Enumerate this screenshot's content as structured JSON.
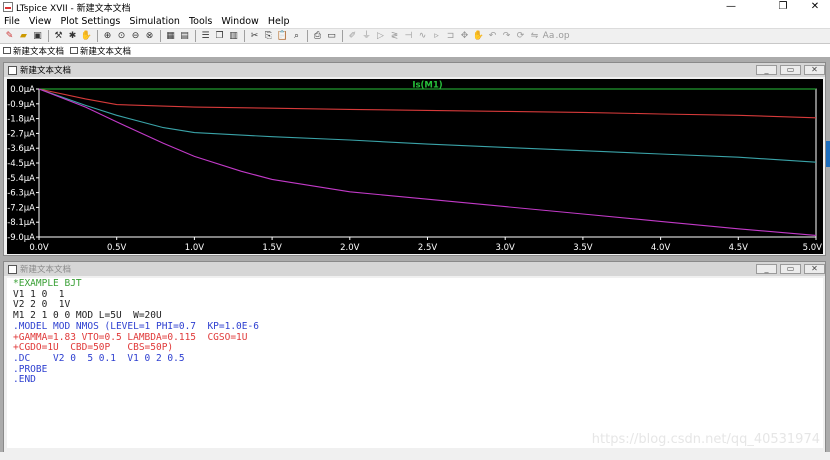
{
  "window": {
    "title": "LTspice XVII - 新建文本文档",
    "minimize": "—",
    "maximize": "❐",
    "close": "✕"
  },
  "menu": [
    "File",
    "View",
    "Plot Settings",
    "Simulation",
    "Tools",
    "Window",
    "Help"
  ],
  "toolbar_icons": [
    "new-schematic",
    "open",
    "save",
    "control-panel",
    "run",
    "halt",
    "zoom-in",
    "zoom-pan",
    "zoom-out",
    "zoom-fit",
    "autorange",
    "fit-all",
    "tile-horizontal",
    "cascade",
    "tile-vertical",
    "cut",
    "copy",
    "paste",
    "find",
    "print",
    "print-setup",
    "draw-wire",
    "ground",
    "label-net",
    "resistor",
    "capacitor",
    "inductor",
    "diode",
    "component",
    "move",
    "drag",
    "undo",
    "redo",
    "rotate",
    "mirror",
    "text",
    "spice-directive"
  ],
  "tabs": [
    {
      "label": "新建文本文档",
      "icon": "waveform-tab-icon"
    },
    {
      "label": "新建文本文档",
      "icon": "netlist-tab-icon"
    }
  ],
  "plot_window": {
    "title": "新建文本文档",
    "min_label": "_",
    "max_label": "▭",
    "close_label": "✕"
  },
  "netlist_window": {
    "title": "新建文本文档",
    "min_label": "_",
    "max_label": "▭",
    "close_label": "✕",
    "lines": [
      {
        "text": "*EXAMPLE BJT",
        "color": "#3aa036"
      },
      {
        "text": "V1 1 0  1",
        "color": "#222222"
      },
      {
        "text": "V2 2 0  1V",
        "color": "#222222"
      },
      {
        "text": "M1 2 1 0 0 MOD L=5U  W=20U",
        "color": "#222222"
      },
      {
        "text": ".MODEL MOD NMOS (LEVEL=1 PHI=0.7  KP=1.0E-6",
        "color": "#2d3fd0"
      },
      {
        "text": "+GAMMA=1.83 VTO=0.5 LAMBDA=0.115  CGSO=1U",
        "color": "#e03a3a"
      },
      {
        "text": "+CGDO=1U  CBD=50P   CBS=50P)",
        "color": "#e03a3a"
      },
      {
        "text": ".DC    V2 0  5 0.1  V1 0 2 0.5",
        "color": "#2d3fd0"
      },
      {
        "text": ".PROBE",
        "color": "#2d3fd0"
      },
      {
        "text": ".END",
        "color": "#2d3fd0"
      }
    ]
  },
  "watermark": "https://blog.csdn.net/qq_40531974",
  "chart_data": {
    "type": "line",
    "title": "",
    "xlabel": "",
    "ylabel": "",
    "x_ticks": [
      "0.0V",
      "0.5V",
      "1.0V",
      "1.5V",
      "2.0V",
      "2.5V",
      "3.0V",
      "3.5V",
      "4.0V",
      "4.5V",
      "5.0V"
    ],
    "y_ticks": [
      "0.0µA",
      "-0.9µA",
      "-1.8µA",
      "-2.7µA",
      "-3.6µA",
      "-4.5µA",
      "-5.4µA",
      "-6.3µA",
      "-7.2µA",
      "-8.1µA",
      "-9.0µA"
    ],
    "xlim": [
      0,
      5
    ],
    "ylim": [
      -9.0,
      0.0
    ],
    "grid": false,
    "legend": "top-center",
    "background": "#000000",
    "axis_color": "#ffffff",
    "series": [
      {
        "name": "Is(M1)",
        "color": "#27c03a",
        "x": [
          0,
          0.3,
          5.0
        ],
        "y": [
          0,
          0,
          0
        ]
      },
      {
        "color": "#d63a3a",
        "x": [
          0,
          0.3,
          0.5,
          1.0,
          1.5,
          2.0,
          2.5,
          3.0,
          3.5,
          4.0,
          4.5,
          5.0
        ],
        "y": [
          0,
          -0.6,
          -0.95,
          -1.1,
          -1.17,
          -1.24,
          -1.3,
          -1.36,
          -1.42,
          -1.52,
          -1.6,
          -1.75
        ]
      },
      {
        "color": "#3aa3a8",
        "x": [
          0,
          0.3,
          0.5,
          0.8,
          1.0,
          1.5,
          2.0,
          2.5,
          3.0,
          3.5,
          4.0,
          4.5,
          5.0
        ],
        "y": [
          0,
          -1.0,
          -1.6,
          -2.35,
          -2.65,
          -2.9,
          -3.1,
          -3.35,
          -3.55,
          -3.75,
          -3.95,
          -4.15,
          -4.45
        ]
      },
      {
        "color": "#c23ac8",
        "x": [
          0,
          0.3,
          0.5,
          0.8,
          1.0,
          1.3,
          1.5,
          2.0,
          2.5,
          3.0,
          3.5,
          4.0,
          4.5,
          5.0
        ],
        "y": [
          0,
          -1.1,
          -2.0,
          -3.3,
          -4.1,
          -5.0,
          -5.5,
          -6.25,
          -6.7,
          -7.15,
          -7.6,
          -8.05,
          -8.5,
          -8.9
        ]
      }
    ]
  }
}
